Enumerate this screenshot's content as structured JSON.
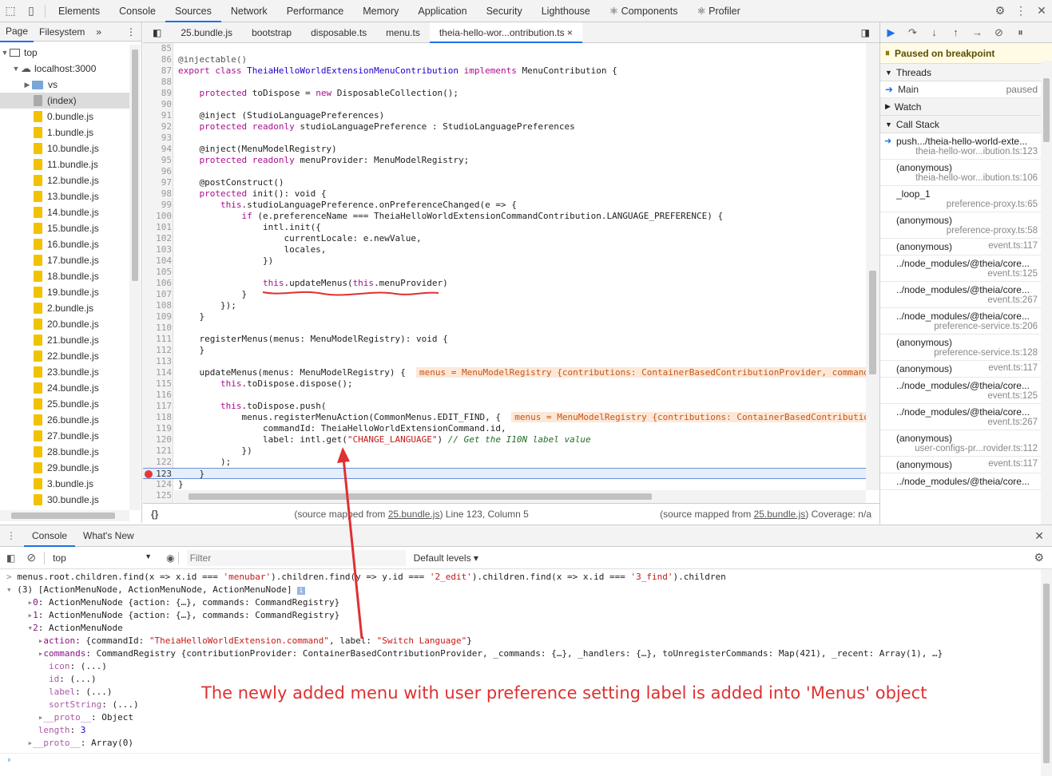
{
  "toolbar": {
    "main_tabs": [
      "Elements",
      "Console",
      "Sources",
      "Network",
      "Performance",
      "Memory",
      "Application",
      "Security",
      "Lighthouse",
      "Components",
      "Profiler"
    ],
    "active": "Sources",
    "components_prefix": "⚛",
    "profiler_prefix": "⚛"
  },
  "navigator": {
    "tabs": [
      "Page",
      "Filesystem"
    ],
    "more": "»",
    "top": "top",
    "host": "localhost:3000",
    "folder": "vs",
    "index": "(index)",
    "files": [
      "0.bundle.js",
      "1.bundle.js",
      "10.bundle.js",
      "11.bundle.js",
      "12.bundle.js",
      "13.bundle.js",
      "14.bundle.js",
      "15.bundle.js",
      "16.bundle.js",
      "17.bundle.js",
      "18.bundle.js",
      "19.bundle.js",
      "2.bundle.js",
      "20.bundle.js",
      "21.bundle.js",
      "22.bundle.js",
      "23.bundle.js",
      "24.bundle.js",
      "25.bundle.js",
      "26.bundle.js",
      "27.bundle.js",
      "28.bundle.js",
      "29.bundle.js",
      "3.bundle.js",
      "30.bundle.js"
    ]
  },
  "editor_tabs": [
    "25.bundle.js",
    "bootstrap",
    "disposable.ts",
    "menu.ts",
    "theia-hello-wor...ontribution.ts"
  ],
  "editor_tab_close": "×",
  "code": {
    "lines": [
      {
        "n": "85",
        "html": ""
      },
      {
        "n": "86",
        "html": "<span class=\"ann\">@injectable()</span>"
      },
      {
        "n": "87",
        "html": "<span class=\"kw\">export</span> <span class=\"kw\">class</span> <span class=\"cls\">TheiaHelloWorldExtensionMenuContribution</span> <span class=\"kw\">implements</span> MenuContribution {"
      },
      {
        "n": "88",
        "html": ""
      },
      {
        "n": "89",
        "html": "    <span class=\"kw\">protected</span> toDispose = <span class=\"kw\">new</span> DisposableCollection();"
      },
      {
        "n": "90",
        "html": ""
      },
      {
        "n": "91",
        "html": "    @inject (StudioLanguagePreferences)"
      },
      {
        "n": "92",
        "html": "    <span class=\"kw\">protected</span> <span class=\"kw\">readonly</span> studioLanguagePreference : StudioLanguagePreferences"
      },
      {
        "n": "93",
        "html": ""
      },
      {
        "n": "94",
        "html": "    @inject(MenuModelRegistry)"
      },
      {
        "n": "95",
        "html": "    <span class=\"kw\">protected</span> <span class=\"kw\">readonly</span> menuProvider: MenuModelRegistry;"
      },
      {
        "n": "96",
        "html": ""
      },
      {
        "n": "97",
        "html": "    @postConstruct()"
      },
      {
        "n": "98",
        "html": "    <span class=\"kw\">protected</span> init(): void {"
      },
      {
        "n": "99",
        "html": "        <span class=\"kw\">this</span>.studioLanguagePreference.onPreferenceChanged(e => {"
      },
      {
        "n": "100",
        "html": "            <span class=\"kw\">if</span> (e.preferenceName === TheiaHelloWorldExtensionCommandContribution.LANGUAGE_PREFERENCE) {"
      },
      {
        "n": "101",
        "html": "                intl.init({"
      },
      {
        "n": "102",
        "html": "                    currentLocale: e.newValue,"
      },
      {
        "n": "103",
        "html": "                    locales,"
      },
      {
        "n": "104",
        "html": "                })"
      },
      {
        "n": "105",
        "html": ""
      },
      {
        "n": "106",
        "html": "                <span class=\"kw\">this</span>.updateMenus(<span class=\"kw\">this</span>.menuProvider)"
      },
      {
        "n": "107",
        "html": "            }"
      },
      {
        "n": "108",
        "html": "        });"
      },
      {
        "n": "109",
        "html": "    }"
      },
      {
        "n": "110",
        "html": ""
      },
      {
        "n": "111",
        "html": "    registerMenus(menus: MenuModelRegistry): void {"
      },
      {
        "n": "112",
        "html": "    }"
      },
      {
        "n": "113",
        "html": ""
      },
      {
        "n": "114",
        "html": "    updateMenus(menus: MenuModelRegistry) {  <span class=\"inl\">menus = MenuModelRegistry {contributions: ContainerBasedContributionProvider, command</span>"
      },
      {
        "n": "115",
        "html": "        <span class=\"kw\">this</span>.toDispose.dispose();"
      },
      {
        "n": "116",
        "html": ""
      },
      {
        "n": "117",
        "html": "        <span class=\"kw\">this</span>.toDispose.push("
      },
      {
        "n": "118",
        "html": "            menus.registerMenuAction(CommonMenus.EDIT_FIND, {  <span class=\"inl\">menus = MenuModelRegistry {contributions: ContainerBasedContributio</span>"
      },
      {
        "n": "119",
        "html": "                commandId: TheiaHelloWorldExtensionCommand.id,"
      },
      {
        "n": "120",
        "html": "                label: intl.get(<span class=\"str\">\"CHANGE_LANGUAGE\"</span>) <span class=\"cmt\">// Get the I10N label value</span>"
      },
      {
        "n": "121",
        "html": "            })"
      },
      {
        "n": "122",
        "html": "        );"
      },
      {
        "n": "123",
        "html": "    }"
      },
      {
        "n": "124",
        "html": "}"
      },
      {
        "n": "125",
        "html": ""
      }
    ],
    "exec_line": "123"
  },
  "status": {
    "braces": "{}",
    "left_prefix": "(source mapped from ",
    "left_link": "25.bundle.js",
    "left_suffix": ") Line 123, Column 5",
    "right_prefix": "(source mapped from ",
    "right_link": "25.bundle.js",
    "right_suffix": ") Coverage: n/a"
  },
  "debugger": {
    "paused": "Paused on breakpoint",
    "threads": "Threads",
    "thread_name": "Main",
    "thread_state": "paused",
    "watch": "Watch",
    "call_stack": "Call Stack",
    "frames": [
      {
        "fn": "push.../theia-hello-world-exte...",
        "loc": "theia-hello-wor...ibution.ts:123",
        "two": true
      },
      {
        "fn": "(anonymous)",
        "loc": "theia-hello-wor...ibution.ts:106",
        "two": true
      },
      {
        "fn": "_loop_1",
        "loc": "preference-proxy.ts:65",
        "two": true
      },
      {
        "fn": "(anonymous)",
        "loc": "preference-proxy.ts:58",
        "two": true
      },
      {
        "fn": "(anonymous)",
        "loc": "event.ts:117",
        "two": false
      },
      {
        "fn": "../node_modules/@theia/core...",
        "loc": "event.ts:125",
        "two": true
      },
      {
        "fn": "../node_modules/@theia/core...",
        "loc": "event.ts:267",
        "two": true
      },
      {
        "fn": "../node_modules/@theia/core...",
        "loc": "preference-service.ts:206",
        "two": true
      },
      {
        "fn": "(anonymous)",
        "loc": "preference-service.ts:128",
        "two": true
      },
      {
        "fn": "(anonymous)",
        "loc": "event.ts:117",
        "two": false
      },
      {
        "fn": "../node_modules/@theia/core...",
        "loc": "event.ts:125",
        "two": true
      },
      {
        "fn": "../node_modules/@theia/core...",
        "loc": "event.ts:267",
        "two": true
      },
      {
        "fn": "(anonymous)",
        "loc": "user-configs-pr...rovider.ts:112",
        "two": true
      },
      {
        "fn": "(anonymous)",
        "loc": "event.ts:117",
        "two": false
      },
      {
        "fn": "../node_modules/@theia/core...",
        "loc": "",
        "two": false
      }
    ]
  },
  "drawer": {
    "tabs": [
      "Console",
      "What's New"
    ],
    "context": "top",
    "filter_placeholder": "Filter",
    "levels": "Default levels ▾"
  },
  "console": {
    "lines": [
      "<span class=\"gr\">&gt;</span> menus.root.children.find(x =&gt; x.id === <span class=\"cstr\">'menubar'</span>).children.find(y =&gt; y.id === <span class=\"cstr\">'2_edit'</span>).children.find(x =&gt; x.id === <span class=\"cstr\">'3_find'</span>).children",
      "<span class=\"gr\">▾</span> (3) [ActionMenuNode, ActionMenuNode, ActionMenuNode] <span style=\"background:#9ab4e4;color:#fff;font-size:9px;padding:0 2px\">i</span>",
      "    <span class=\"gr\">▸</span><span class=\"prop\">0</span>: ActionMenuNode {action: {…}, commands: CommandRegistry}",
      "    <span class=\"gr\">▸</span><span class=\"prop\">1</span>: ActionMenuNode {action: {…}, commands: CommandRegistry}",
      "    <span class=\"gr\">▾</span><span class=\"prop\">2</span>: ActionMenuNode",
      "      <span class=\"gr\">▸</span><span class=\"prop\">action</span>: {commandId: <span class=\"cstr\">\"TheiaHelloWorldExtension.command\"</span>, label: <span class=\"cstr\">\"Switch Language\"</span>}",
      "      <span class=\"gr\">▸</span><span class=\"prop\">commands</span>: CommandRegistry {contributionProvider: ContainerBasedContributionProvider, _commands: {…}, _handlers: {…}, toUnregisterCommands: Map(421), _recent: Array(1), …}",
      "        <span class=\"prop\" style=\"opacity:.7\">icon</span>: (...)",
      "        <span class=\"prop\" style=\"opacity:.7\">id</span>: (...)",
      "        <span class=\"prop\" style=\"opacity:.7\">label</span>: (...)",
      "        <span class=\"prop\" style=\"opacity:.7\">sortString</span>: (...)",
      "      <span class=\"gr\">▸</span><span class=\"prop\" style=\"opacity:.7\">__proto__</span>: Object",
      "      <span class=\"prop\" style=\"opacity:.7\">length</span>: <span class=\"num\">3</span>",
      "    <span class=\"gr\">▸</span><span class=\"prop\" style=\"opacity:.7\">__proto__</span>: Array(0)"
    ],
    "prompt": "›"
  },
  "annotation": "The newly added menu with user preference setting label is added into 'Menus' object",
  "colors": {
    "accent": "#1a73e8",
    "breakpoint": "#e53935",
    "annotation": "#e03030"
  }
}
